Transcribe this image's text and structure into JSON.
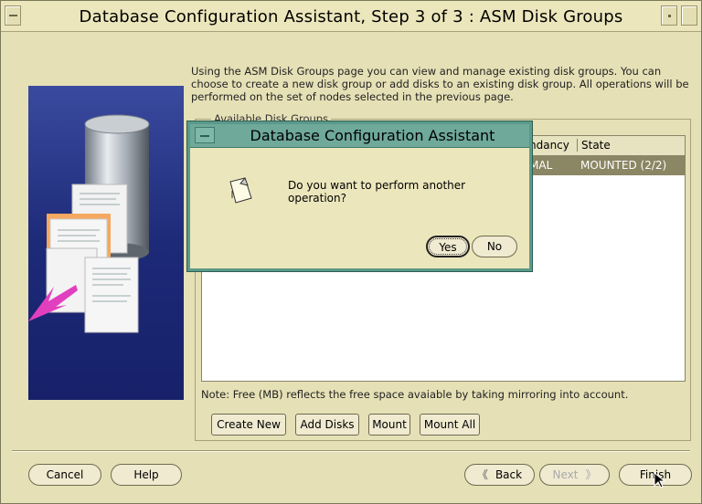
{
  "window": {
    "title": "Database Configuration Assistant, Step 3 of 3 : ASM Disk Groups"
  },
  "intro": "Using the ASM Disk Groups page you can view and manage existing disk groups.  You can choose to create a new disk group or add disks to an existing disk group.  All operations will be performed on the set of nodes selected in the previous page.",
  "group": {
    "legend": "Available Disk Groups"
  },
  "table": {
    "headers": {
      "redundancy": "ndancy",
      "state": "State"
    },
    "rows": [
      {
        "redundancy": "MAL",
        "state": "MOUNTED (2/2)"
      }
    ]
  },
  "note": "Note: Free (MB) reflects the free space avaiable by taking mirroring into account.",
  "actions": {
    "create_new": "Create New",
    "add_disks": "Add Disks",
    "mount": "Mount",
    "mount_all": "Mount All"
  },
  "footer": {
    "cancel": "Cancel",
    "help": "Help",
    "back": "Back",
    "next": "Next",
    "finish": "Finish"
  },
  "dialog": {
    "title": "Database Configuration Assistant",
    "message": "Do you want to perform another operation?",
    "yes": "Yes",
    "no": "No"
  },
  "colors": {
    "window_bg": "#e6e0b6",
    "dialog_border": "#5a9a8a",
    "selected_row": "#8b8663",
    "banner": "#1d2a78"
  }
}
